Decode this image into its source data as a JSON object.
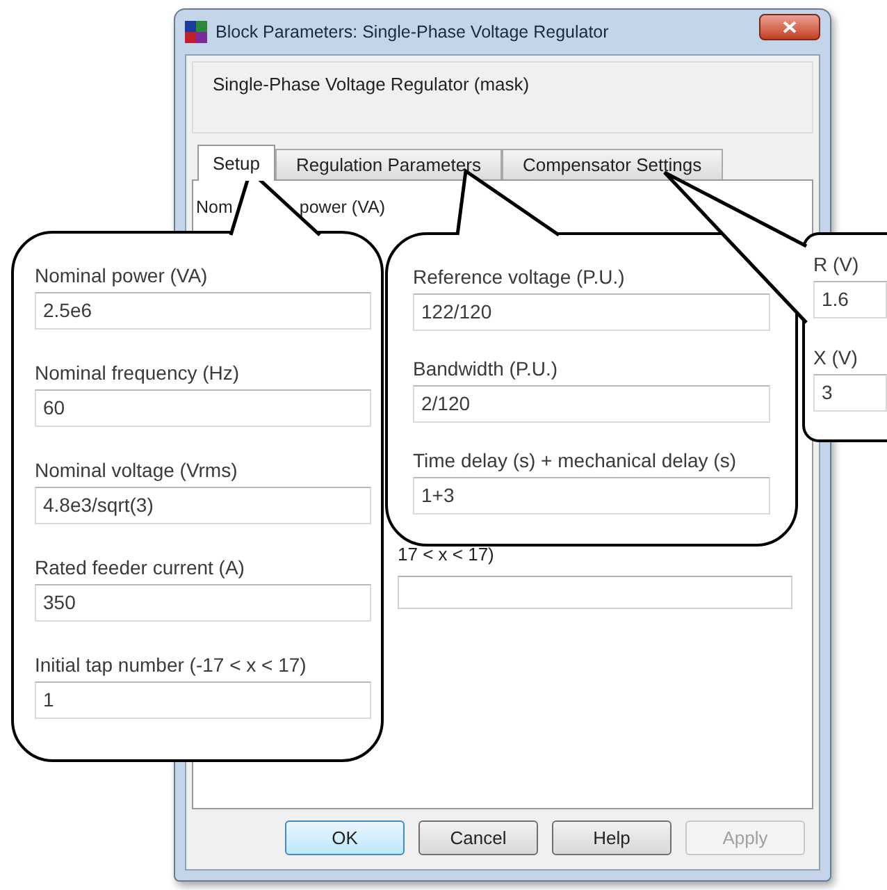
{
  "window": {
    "title": "Block Parameters: Single-Phase Voltage Regulator"
  },
  "mask_title": "Single-Phase Voltage Regulator (mask)",
  "tabs": [
    {
      "label": "Setup",
      "selected": true
    },
    {
      "label": "Regulation Parameters",
      "selected": false
    },
    {
      "label": "Compensator Settings",
      "selected": false
    }
  ],
  "panel": {
    "label_parts": [
      "Nom",
      "power (VA)"
    ],
    "partial_label": "17 < x < 17)"
  },
  "callouts": [
    {
      "fields": [
        {
          "label": "Nominal power (VA)",
          "value": "2.5e6"
        },
        {
          "label": "Nominal frequency (Hz)",
          "value": "60"
        },
        {
          "label": "Nominal voltage (Vrms)",
          "value": "4.8e3/sqrt(3)"
        },
        {
          "label": "Rated feeder current (A)",
          "value": "350"
        },
        {
          "label": "Initial tap number (-17 < x < 17)",
          "value": "1"
        }
      ]
    },
    {
      "fields": [
        {
          "label": "Reference voltage (P.U.)",
          "value": "122/120"
        },
        {
          "label": "Bandwidth (P.U.)",
          "value": "2/120"
        },
        {
          "label": "Time delay (s) + mechanical delay (s)",
          "value": "1+3"
        }
      ]
    },
    {
      "fields": [
        {
          "label": "R (V)",
          "value": "1.6"
        },
        {
          "label": "X (V)",
          "value": "3"
        }
      ]
    }
  ],
  "buttons": [
    {
      "label": "OK",
      "default": true,
      "disabled": false
    },
    {
      "label": "Cancel",
      "default": false,
      "disabled": false
    },
    {
      "label": "Help",
      "default": false,
      "disabled": false
    },
    {
      "label": "Apply",
      "default": false,
      "disabled": true
    }
  ]
}
